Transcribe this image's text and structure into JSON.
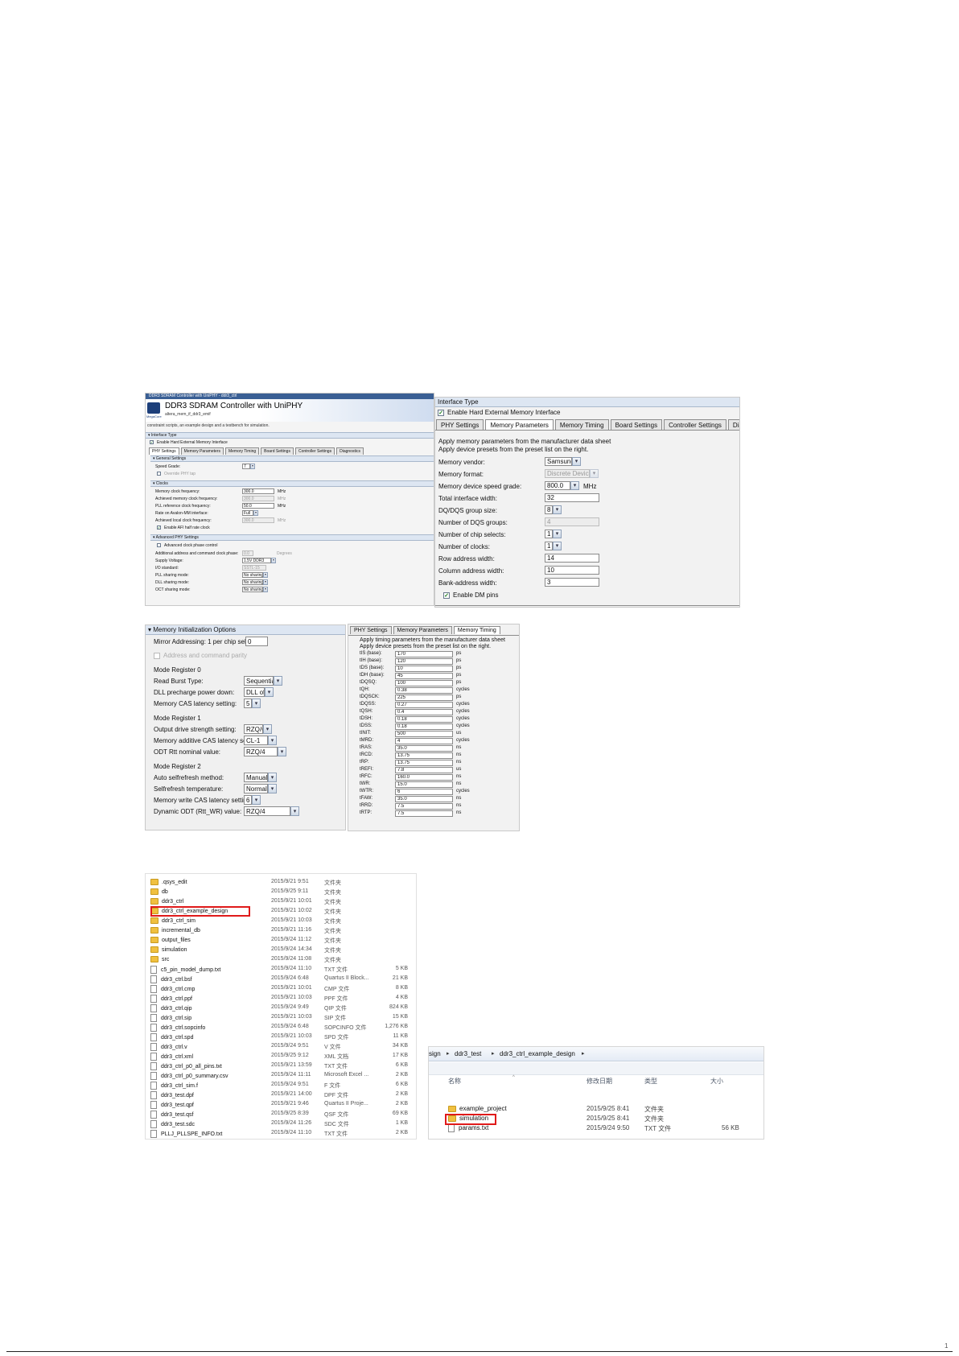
{
  "megawizard": {
    "window_title": "DDR3 SDRAM Controller with UniPHY - ddr3_ctrl",
    "product_title": "DDR3 SDRAM Controller with UniPHY",
    "instance_name": "altera_mem_if_ddr3_emif",
    "logo_text": "MegaCore",
    "description": "constraint scripts, an example design and a testbench for simulation.",
    "interface_type_header": "Interface Type",
    "enable_hard_emif": "Enable Hard External Memory Interface",
    "tabs": [
      "PHY Settings",
      "Memory Parameters",
      "Memory Timing",
      "Board Settings",
      "Controller Settings",
      "Diagnostics"
    ],
    "general_header": "General Settings",
    "speed_grade_label": "Speed Grade:",
    "speed_grade_value": "7",
    "override_phy": "Override PHY tap",
    "clocks_header": "Clocks",
    "clocks": [
      {
        "label": "Memory clock frequency:",
        "value": "300.0",
        "unit": "MHz"
      },
      {
        "label": "Achieved memory clock frequency:",
        "value": "300.0",
        "unit": "MHz"
      },
      {
        "label": "PLL reference clock frequency:",
        "value": "50.0",
        "unit": "MHz"
      },
      {
        "label": "Rate on Avalon-MM interface:",
        "value": "Full",
        "unit": ""
      },
      {
        "label": "Achieved local clock frequency:",
        "value": "300.0",
        "unit": "MHz"
      }
    ],
    "enable_afi": "Enable AFI half rate clock",
    "adv_phy_header": "Advanced PHY Settings",
    "adv_clock_phase": "Advanced clock phase control",
    "adv_rows": [
      {
        "label": "Additional address and command clock phase:",
        "value": "0.0",
        "unit": "Degrees"
      },
      {
        "label": "Supply Voltage:",
        "value": "1.5V DDR3",
        "unit": ""
      },
      {
        "label": "I/O standard:",
        "value": "SSTL-15",
        "unit": ""
      },
      {
        "label": "PLL sharing mode:",
        "value": "No sharing",
        "unit": ""
      },
      {
        "label": "DLL sharing mode:",
        "value": "No sharing",
        "unit": ""
      },
      {
        "label": "OCT sharing mode:",
        "value": "No sharing",
        "unit": ""
      }
    ]
  },
  "memparams": {
    "header": "Interface Type",
    "enable_hard_emif": "Enable Hard External Memory Interface",
    "tabs": [
      "PHY Settings",
      "Memory Parameters",
      "Memory Timing",
      "Board Settings",
      "Controller Settings",
      "Diagnostics"
    ],
    "intro1": "Apply memory parameters from the manufacturer data sheet",
    "intro2": "Apply device presets from the preset list on the right.",
    "rows": [
      {
        "label": "Memory vendor:",
        "value": "Samsung",
        "unit": "",
        "kind": "dd"
      },
      {
        "label": "Memory format:",
        "value": "Discrete Device",
        "unit": "",
        "kind": "dd-dis"
      },
      {
        "label": "Memory device speed grade:",
        "value": "800.0",
        "unit": "MHz",
        "kind": "dd"
      },
      {
        "label": "Total interface width:",
        "value": "32",
        "unit": "",
        "kind": "tb"
      },
      {
        "label": "DQ/DQS group size:",
        "value": "8",
        "unit": "",
        "kind": "dd"
      },
      {
        "label": "Number of DQS groups:",
        "value": "4",
        "unit": "",
        "kind": "tb-dis"
      },
      {
        "label": "Number of chip selects:",
        "value": "1",
        "unit": "",
        "kind": "dd"
      },
      {
        "label": "Number of clocks:",
        "value": "1",
        "unit": "",
        "kind": "dd"
      },
      {
        "label": "Row address width:",
        "value": "14",
        "unit": "",
        "kind": "tb"
      },
      {
        "label": "Column address width:",
        "value": "10",
        "unit": "",
        "kind": "tb"
      },
      {
        "label": "Bank-address width:",
        "value": "3",
        "unit": "",
        "kind": "tb"
      }
    ],
    "enable_dm": "Enable DM pins"
  },
  "meminit": {
    "header": "Memory Initialization Options",
    "mirror_label": "Mirror Addressing: 1 per chip select:",
    "mirror_value": "0",
    "addr_parity": "Address and command parity",
    "groups": [
      {
        "title": "Mode Register 0",
        "rows": [
          {
            "label": "Read Burst Type:",
            "value": "Sequential"
          },
          {
            "label": "DLL precharge power down:",
            "value": "DLL off"
          },
          {
            "label": "Memory CAS latency setting:",
            "value": "5"
          }
        ]
      },
      {
        "title": "Mode Register 1",
        "rows": [
          {
            "label": "Output drive strength setting:",
            "value": "RZQ/6"
          },
          {
            "label": "Memory additive CAS latency setting:",
            "value": "CL-1"
          },
          {
            "label": "ODT Rtt nominal value:",
            "value": "RZQ/4"
          }
        ]
      },
      {
        "title": "Mode Register 2",
        "rows": [
          {
            "label": "Auto selfrefresh method:",
            "value": "Manual"
          },
          {
            "label": "Selfrefresh temperature:",
            "value": "Normal"
          },
          {
            "label": "Memory write CAS latency setting:",
            "value": "6"
          },
          {
            "label": "Dynamic ODT (Rtt_WR) value:",
            "value": "RZQ/4"
          }
        ]
      }
    ]
  },
  "timing": {
    "tabs": [
      "PHY Settings",
      "Memory Parameters",
      "Memory Timing"
    ],
    "intro1": "Apply timing parameters from the manufacturer data sheet",
    "intro2": "Apply device presets from the preset list on the right.",
    "rows": [
      {
        "label": "tIS (base):",
        "value": "170",
        "unit": "ps"
      },
      {
        "label": "tIH (base):",
        "value": "120",
        "unit": "ps"
      },
      {
        "label": "tDS (base):",
        "value": "10",
        "unit": "ps"
      },
      {
        "label": "tDH (base):",
        "value": "45",
        "unit": "ps"
      },
      {
        "label": "tDQSQ:",
        "value": "100",
        "unit": "ps"
      },
      {
        "label": "tQH:",
        "value": "0.38",
        "unit": "cycles"
      },
      {
        "label": "tDQSCK:",
        "value": "225",
        "unit": "ps"
      },
      {
        "label": "tDQSS:",
        "value": "0.27",
        "unit": "cycles"
      },
      {
        "label": "tQSH:",
        "value": "0.4",
        "unit": "cycles"
      },
      {
        "label": "tDSH:",
        "value": "0.18",
        "unit": "cycles"
      },
      {
        "label": "tDSS:",
        "value": "0.18",
        "unit": "cycles"
      },
      {
        "label": "tINIT:",
        "value": "500",
        "unit": "us"
      },
      {
        "label": "tMRD:",
        "value": "4",
        "unit": "cycles"
      },
      {
        "label": "tRAS:",
        "value": "35.0",
        "unit": "ns"
      },
      {
        "label": "tRCD:",
        "value": "13.75",
        "unit": "ns"
      },
      {
        "label": "tRP:",
        "value": "13.75",
        "unit": "ns"
      },
      {
        "label": "tREFI:",
        "value": "7.8",
        "unit": "us"
      },
      {
        "label": "tRFC:",
        "value": "160.0",
        "unit": "ns"
      },
      {
        "label": "tWR:",
        "value": "15.0",
        "unit": "ns"
      },
      {
        "label": "tWTR:",
        "value": "6",
        "unit": "cycles"
      },
      {
        "label": "tFAW:",
        "value": "35.0",
        "unit": "ns"
      },
      {
        "label": "tRRD:",
        "value": "7.5",
        "unit": "ns"
      },
      {
        "label": "tRTP:",
        "value": "7.5",
        "unit": "ns"
      }
    ]
  },
  "explorer1": {
    "rows": [
      {
        "name": ".qsys_edit",
        "date": "2015/9/21 9:51",
        "type": "文件夹",
        "size": "",
        "icon": "folder"
      },
      {
        "name": "db",
        "date": "2015/9/25 9:11",
        "type": "文件夹",
        "size": "",
        "icon": "folder"
      },
      {
        "name": "ddr3_ctrl",
        "date": "2015/9/21 10:01",
        "type": "文件夹",
        "size": "",
        "icon": "folder"
      },
      {
        "name": "ddr3_ctrl_example_design",
        "date": "2015/9/21 10:02",
        "type": "文件夹",
        "size": "",
        "icon": "folder"
      },
      {
        "name": "ddr3_ctrl_sim",
        "date": "2015/9/21 10:03",
        "type": "文件夹",
        "size": "",
        "icon": "folder"
      },
      {
        "name": "incremental_db",
        "date": "2015/9/21 11:16",
        "type": "文件夹",
        "size": "",
        "icon": "folder"
      },
      {
        "name": "output_files",
        "date": "2015/9/24 11:12",
        "type": "文件夹",
        "size": "",
        "icon": "folder"
      },
      {
        "name": "simulation",
        "date": "2015/9/24 14:34",
        "type": "文件夹",
        "size": "",
        "icon": "folder"
      },
      {
        "name": "src",
        "date": "2015/9/24 11:08",
        "type": "文件夹",
        "size": "",
        "icon": "folder"
      },
      {
        "name": "c5_pin_model_dump.txt",
        "date": "2015/9/24 11:10",
        "type": "TXT 文件",
        "size": "5 KB",
        "icon": "file"
      },
      {
        "name": "ddr3_ctrl.bsf",
        "date": "2015/9/24 6:48",
        "type": "Quartus II Block...",
        "size": "21 KB",
        "icon": "file"
      },
      {
        "name": "ddr3_ctrl.cmp",
        "date": "2015/9/21 10:01",
        "type": "CMP 文件",
        "size": "8 KB",
        "icon": "file"
      },
      {
        "name": "ddr3_ctrl.ppf",
        "date": "2015/9/21 10:03",
        "type": "PPF 文件",
        "size": "4 KB",
        "icon": "file"
      },
      {
        "name": "ddr3_ctrl.qip",
        "date": "2015/9/24 9:49",
        "type": "QIP 文件",
        "size": "824 KB",
        "icon": "file"
      },
      {
        "name": "ddr3_ctrl.sip",
        "date": "2015/9/21 10:03",
        "type": "SIP 文件",
        "size": "15 KB",
        "icon": "file"
      },
      {
        "name": "ddr3_ctrl.sopcinfo",
        "date": "2015/9/24 6:48",
        "type": "SOPCINFO 文件",
        "size": "1,276 KB",
        "icon": "file"
      },
      {
        "name": "ddr3_ctrl.spd",
        "date": "2015/9/21 10:03",
        "type": "SPD 文件",
        "size": "11 KB",
        "icon": "file"
      },
      {
        "name": "ddr3_ctrl.v",
        "date": "2015/9/24 9:51",
        "type": "V 文件",
        "size": "34 KB",
        "icon": "file"
      },
      {
        "name": "ddr3_ctrl.xml",
        "date": "2015/9/25 9:12",
        "type": "XML 文档",
        "size": "17 KB",
        "icon": "file"
      },
      {
        "name": "ddr3_ctrl_p0_all_pins.txt",
        "date": "2015/9/21 13:59",
        "type": "TXT 文件",
        "size": "6 KB",
        "icon": "file"
      },
      {
        "name": "ddr3_ctrl_p0_summary.csv",
        "date": "2015/9/24 11:11",
        "type": "Microsoft Excel ...",
        "size": "2 KB",
        "icon": "file"
      },
      {
        "name": "ddr3_ctrl_sim.f",
        "date": "2015/9/24 9:51",
        "type": "F 文件",
        "size": "6 KB",
        "icon": "file"
      },
      {
        "name": "ddr3_test.dpf",
        "date": "2015/9/21 14:00",
        "type": "DPF 文件",
        "size": "2 KB",
        "icon": "file"
      },
      {
        "name": "ddr3_test.qpf",
        "date": "2015/9/21 9:46",
        "type": "Quartus II Proje...",
        "size": "2 KB",
        "icon": "file"
      },
      {
        "name": "ddr3_test.qsf",
        "date": "2015/9/25 8:39",
        "type": "QSF 文件",
        "size": "69 KB",
        "icon": "file"
      },
      {
        "name": "ddr3_test.sdc",
        "date": "2015/9/24 11:26",
        "type": "SDC 文件",
        "size": "1 KB",
        "icon": "file"
      },
      {
        "name": "PLLJ_PLLSPE_INFO.txt",
        "date": "2015/9/24 11:10",
        "type": "TXT 文件",
        "size": "2 KB",
        "icon": "file"
      }
    ]
  },
  "explorer2": {
    "breadcrumb": [
      "sign",
      "ddr3_test",
      "ddr3_ctrl_example_design"
    ],
    "col_name": "名称",
    "col_date": "修改日期",
    "col_type": "类型",
    "col_size": "大小",
    "rows": [
      {
        "name": "example_project",
        "date": "2015/9/25 8:41",
        "type": "文件夹",
        "size": "",
        "icon": "folder"
      },
      {
        "name": "simulation",
        "date": "2015/9/25 8:41",
        "type": "文件夹",
        "size": "",
        "icon": "folder"
      },
      {
        "name": "params.txt",
        "date": "2015/9/24 9:50",
        "type": "TXT 文件",
        "size": "56 KB",
        "icon": "file"
      }
    ]
  },
  "footer": {
    "page_marker": "1"
  }
}
